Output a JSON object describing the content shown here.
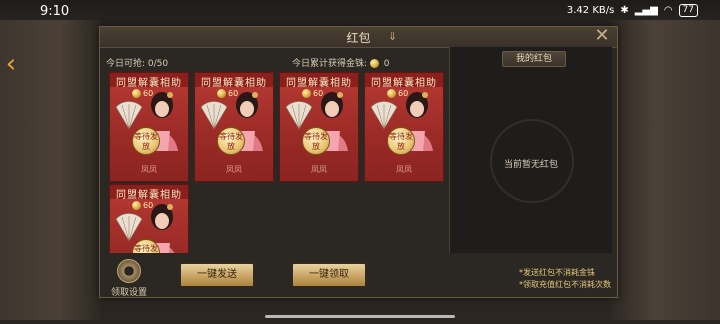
{
  "status": {
    "time": "9:10",
    "net_speed": "3.42 KB/s",
    "battery": "77"
  },
  "modal": {
    "title": "红包",
    "daily_grab": "今日可抢: 0/50",
    "daily_coins_label": "今日累计获得金铢:",
    "daily_coins_value": "0"
  },
  "cards": [
    {
      "title": "同盟解囊相助",
      "amount": "60",
      "badge": "等待发放",
      "sender": "凤凤"
    },
    {
      "title": "同盟解囊相助",
      "amount": "60",
      "badge": "等待发放",
      "sender": "凤凤"
    },
    {
      "title": "同盟解囊相助",
      "amount": "60",
      "badge": "等待发放",
      "sender": "凤凤"
    },
    {
      "title": "同盟解囊相助",
      "amount": "60",
      "badge": "等待发放",
      "sender": "凤凤"
    },
    {
      "title": "同盟解囊相助",
      "amount": "60",
      "badge": "等待发放",
      "sender": "凤凤"
    }
  ],
  "right_panel": {
    "tab": "我的红包",
    "empty_text": "当前暂无红包"
  },
  "footer": {
    "settings_label": "领取设置",
    "send_all": "一键发送",
    "claim_all": "一键领取",
    "note1": "*发送红包不消耗金铢",
    "note2": "*领取充值红包不消耗次数"
  },
  "colors": {
    "card_red": "#b83a33",
    "button_gold": "#c9a566",
    "note_gold": "#e6c57a"
  }
}
